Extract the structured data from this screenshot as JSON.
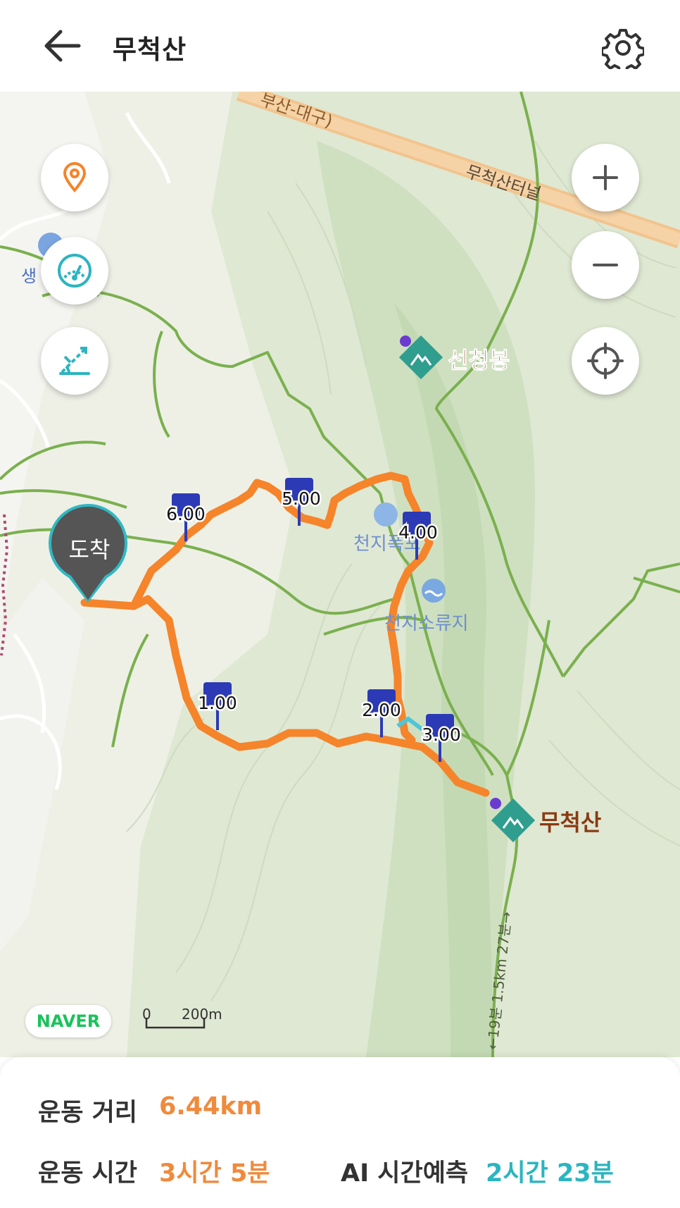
{
  "header": {
    "title": "무척산",
    "back_icon": "arrow-left-icon",
    "settings_icon": "gear-icon"
  },
  "map": {
    "road_label": "부산-대구)",
    "tunnel_label": "무척산터널",
    "partial_label": "생",
    "peaks": {
      "seoncheongbong": "선청봉",
      "mucheoksan": "무척산"
    },
    "pois": {
      "falls": "천지폭포",
      "reservoir": "천지소류지"
    },
    "trail_note": "←19분 1.5km 27분→",
    "arrival_label": "도착",
    "km_markers": [
      "1.00",
      "2.00",
      "3.00",
      "4.00",
      "5.00",
      "6.00"
    ],
    "scale": {
      "zero": "0",
      "length": "200m"
    },
    "provider": "NAVER",
    "colors": {
      "route": "#f5842a",
      "marker": "#2c3ab5",
      "trail": "#7ab04e",
      "road": "#f3c28a"
    }
  },
  "controls": [
    "location-pin-icon",
    "speedometer-icon",
    "slope-icon",
    "zoom-in-icon",
    "zoom-out-icon",
    "crosshair-icon"
  ],
  "stats": {
    "distance_label": "운동 거리",
    "distance_value": "6.44km",
    "time_label": "운동 시간",
    "time_value": "3시간 5분",
    "ai_label": "AI 시간예측",
    "ai_value": "2시간 23분"
  }
}
